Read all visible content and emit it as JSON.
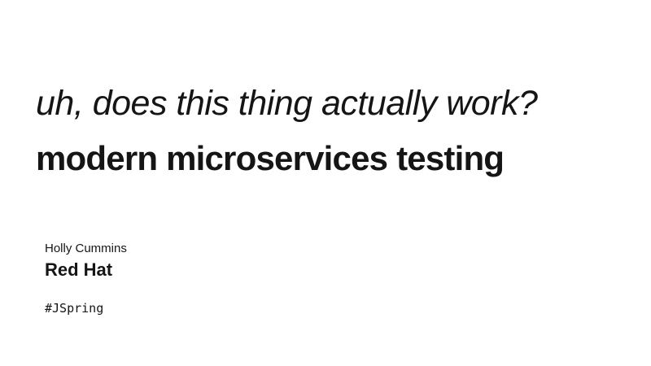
{
  "slide": {
    "subtitle": "uh, does this thing actually work?",
    "title": "modern microservices testing",
    "author": "Holly Cummins",
    "company": "Red Hat",
    "hashtag": "#JSpring"
  },
  "colors": {
    "background": "#ffffff",
    "text": "#151515"
  }
}
